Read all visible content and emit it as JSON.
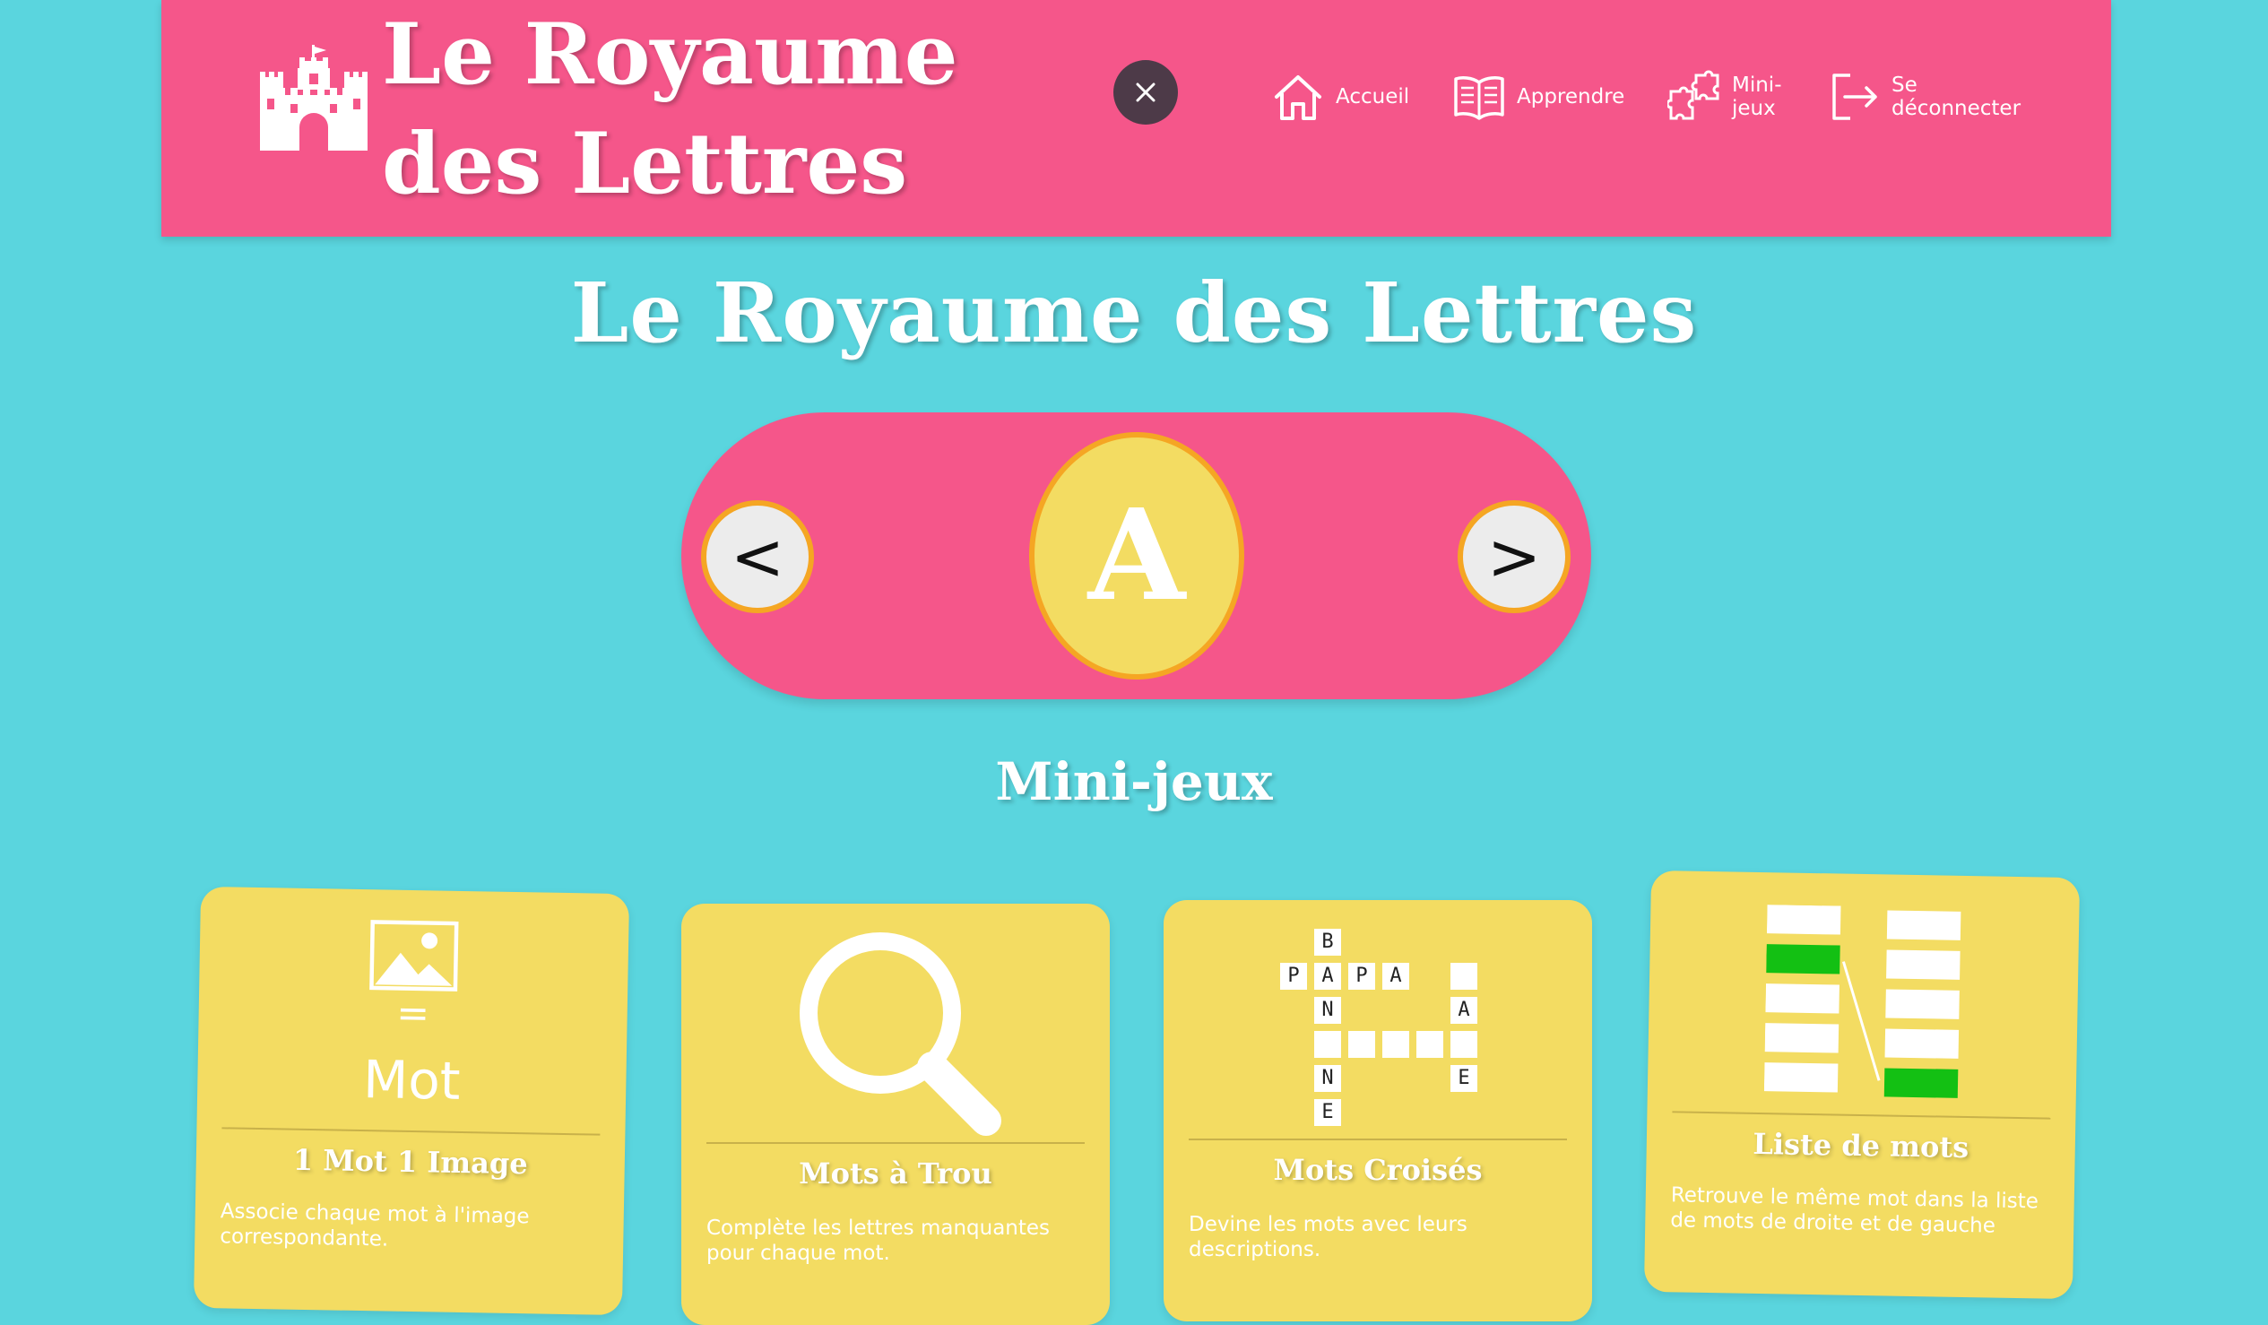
{
  "header": {
    "site_title": "Le Royaume des Lettres",
    "nav": [
      {
        "label": "Accueil",
        "icon": "home-icon"
      },
      {
        "label": "Apprendre",
        "icon": "book-icon"
      },
      {
        "label": "Mini-jeux",
        "icon": "puzzle-icon"
      },
      {
        "label": "Se déconnecter",
        "icon": "logout-icon"
      }
    ],
    "close_symbol": "×"
  },
  "main": {
    "title": "Le Royaume des Lettres",
    "letter_selector": {
      "prev": "<",
      "current": "A",
      "next": ">"
    },
    "section_title": "Mini-jeux"
  },
  "cards": [
    {
      "title": "1 Mot 1 Image",
      "description": "Associe chaque mot à l'image correspondante.",
      "art_text_equals": "=",
      "art_text_word": "Mot"
    },
    {
      "title": "Mots à Trou",
      "description": "Complète les lettres manquantes pour chaque mot."
    },
    {
      "title": "Mots Croisés",
      "description": "Devine les mots avec leurs descriptions.",
      "crossword_letters": [
        "B",
        "P",
        "A",
        "P",
        "A",
        "N",
        "A",
        "N",
        "E",
        "E"
      ]
    },
    {
      "title": "Liste de mots",
      "description": "Retrouve le même mot dans la liste de mots de droite et de gauche"
    }
  ],
  "colors": {
    "background": "#5ad5de",
    "header_pink": "#f5568a",
    "card_yellow": "#f3dc62",
    "accent_orange": "#f5a623",
    "match_green": "#13c013"
  }
}
